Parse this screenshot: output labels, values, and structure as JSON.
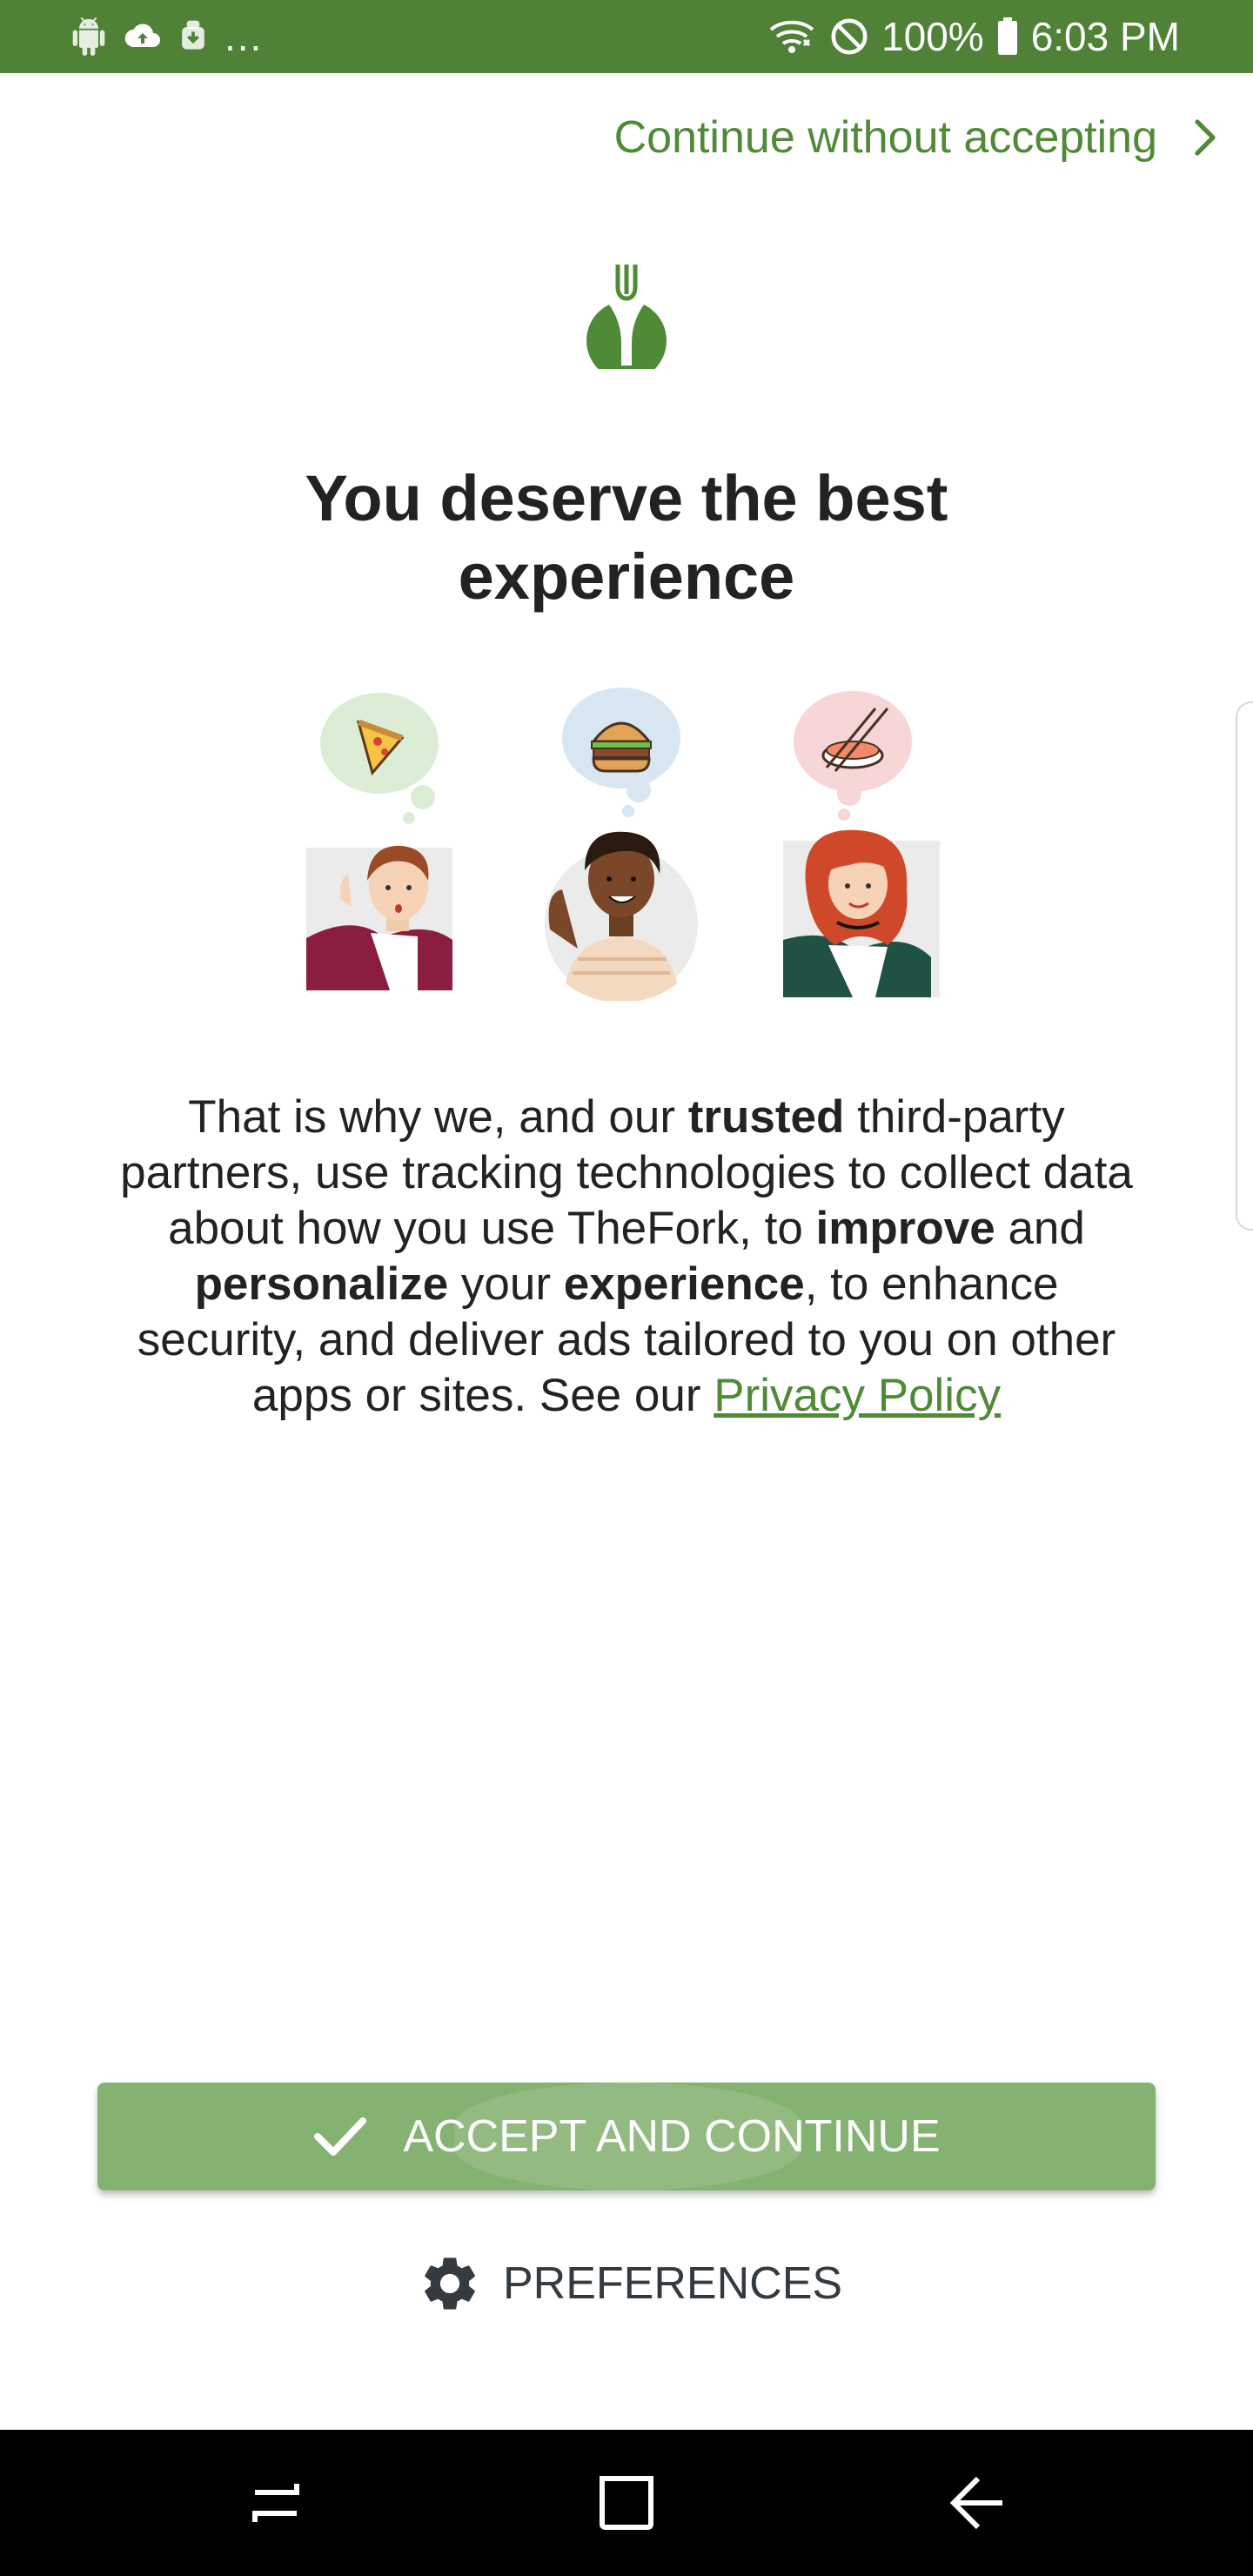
{
  "status_bar": {
    "left_icons": [
      "android-icon",
      "cloud-sync-icon",
      "android-download-icon"
    ],
    "ellipsis": "...",
    "right_icons": [
      "wifi-icon",
      "do-not-disturb-icon",
      "battery-icon"
    ],
    "battery": "100%",
    "time": "6:03 PM"
  },
  "header": {
    "skip_label": "Continue without accepting",
    "skip_icon": "chevron-right-icon",
    "logo_icon": "thefork-logo-icon",
    "title": "You deserve the best experience"
  },
  "illustration": {
    "thoughts": [
      "pizza-icon",
      "burger-icon",
      "sushi-icon"
    ]
  },
  "body": {
    "t1": "That is why we, and our ",
    "b1": "trusted",
    "t2": " third-party partners, use tracking technologies to collect data about how you use TheFork, to ",
    "b2": "improve",
    "t3": " and ",
    "b3": "personalize",
    "t4": " your ",
    "b4": "experience",
    "t5": ", to enhance security, and deliver ads tailored to you on other apps or sites. See our ",
    "link": "Privacy Policy"
  },
  "actions": {
    "accept_label": "ACCEPT AND CONTINUE",
    "accept_icon": "check-icon",
    "preferences_label": "PREFERENCES",
    "preferences_icon": "gear-icon"
  },
  "nav": {
    "buttons": [
      "recents-icon",
      "home-icon",
      "back-icon"
    ]
  },
  "colors": {
    "brand_green": "#4f8236",
    "button_green": "#84b270",
    "link_green": "#4f8a36"
  }
}
